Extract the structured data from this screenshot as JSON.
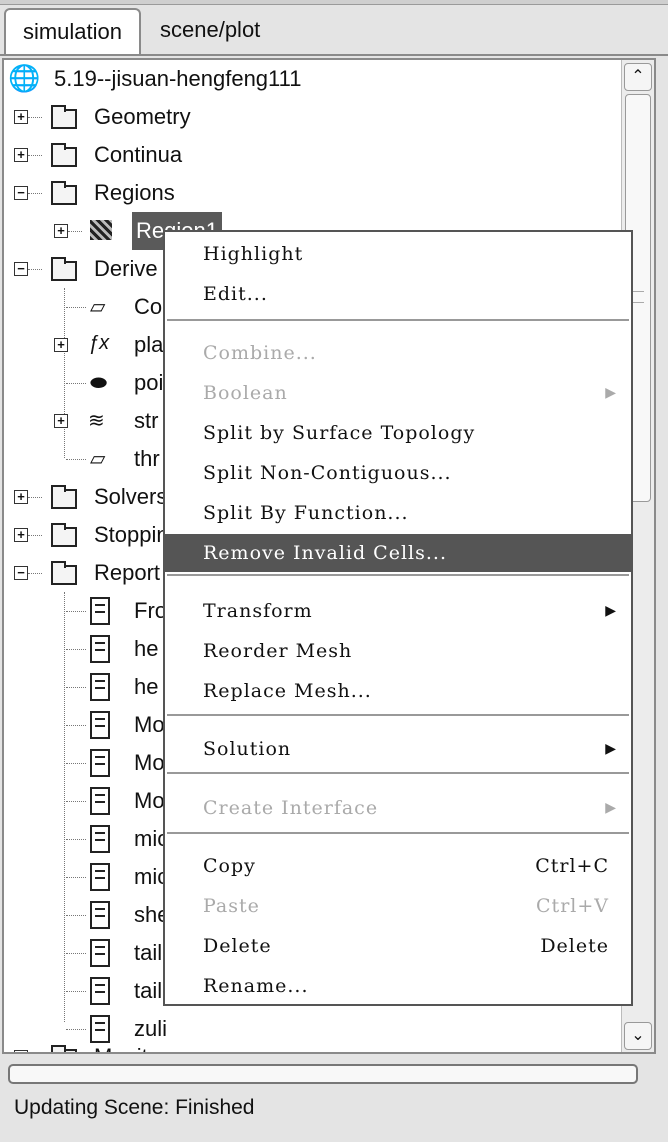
{
  "tabs": [
    "simulation",
    "scene/plot"
  ],
  "tree": {
    "root": "5.19--jisuan-hengfeng111",
    "geometry": "Geometry",
    "continua": "Continua",
    "regions": "Regions",
    "region1": "Region1",
    "derived": "Derive",
    "derived_items": [
      "Co",
      "pla",
      "poi",
      "str",
      "thr"
    ],
    "solvers": "Solvers",
    "stopping": "Stoppin",
    "reports": "Report",
    "report_items": [
      "Fro",
      "he",
      "he",
      "Mo",
      "Mo",
      "Mo",
      "mic",
      "mic",
      "she",
      "tail",
      "tail",
      "zuli"
    ],
    "monitors": "Monitors"
  },
  "context_menu": {
    "items": [
      {
        "label": "Highlight",
        "enabled": true
      },
      {
        "label": "Edit...",
        "enabled": true
      },
      {
        "label": "Combine...",
        "enabled": false
      },
      {
        "label": "Boolean",
        "enabled": false,
        "submenu": true
      },
      {
        "label": "Split by Surface Topology",
        "enabled": true
      },
      {
        "label": "Split Non-Contiguous...",
        "enabled": true
      },
      {
        "label": "Split By Function...",
        "enabled": true
      },
      {
        "label": "Remove Invalid Cells...",
        "enabled": true,
        "highlighted": true
      },
      {
        "label": "Transform",
        "enabled": true,
        "submenu": true
      },
      {
        "label": "Reorder Mesh",
        "enabled": true
      },
      {
        "label": "Replace Mesh...",
        "enabled": true
      },
      {
        "label": "Solution",
        "enabled": true,
        "submenu": true
      },
      {
        "label": "Create Interface",
        "enabled": false,
        "submenu": true
      },
      {
        "label": "Copy",
        "enabled": true,
        "shortcut": "Ctrl+C"
      },
      {
        "label": "Paste",
        "enabled": false,
        "shortcut": "Ctrl+V"
      },
      {
        "label": "Delete",
        "enabled": true,
        "shortcut": "Delete"
      },
      {
        "label": "Rename...",
        "enabled": true
      }
    ]
  },
  "status": {
    "text": "Updating Scene: Finished"
  },
  "colors": {
    "selection": "#5a5a5a",
    "disabled_text": "#aaaaaa"
  }
}
